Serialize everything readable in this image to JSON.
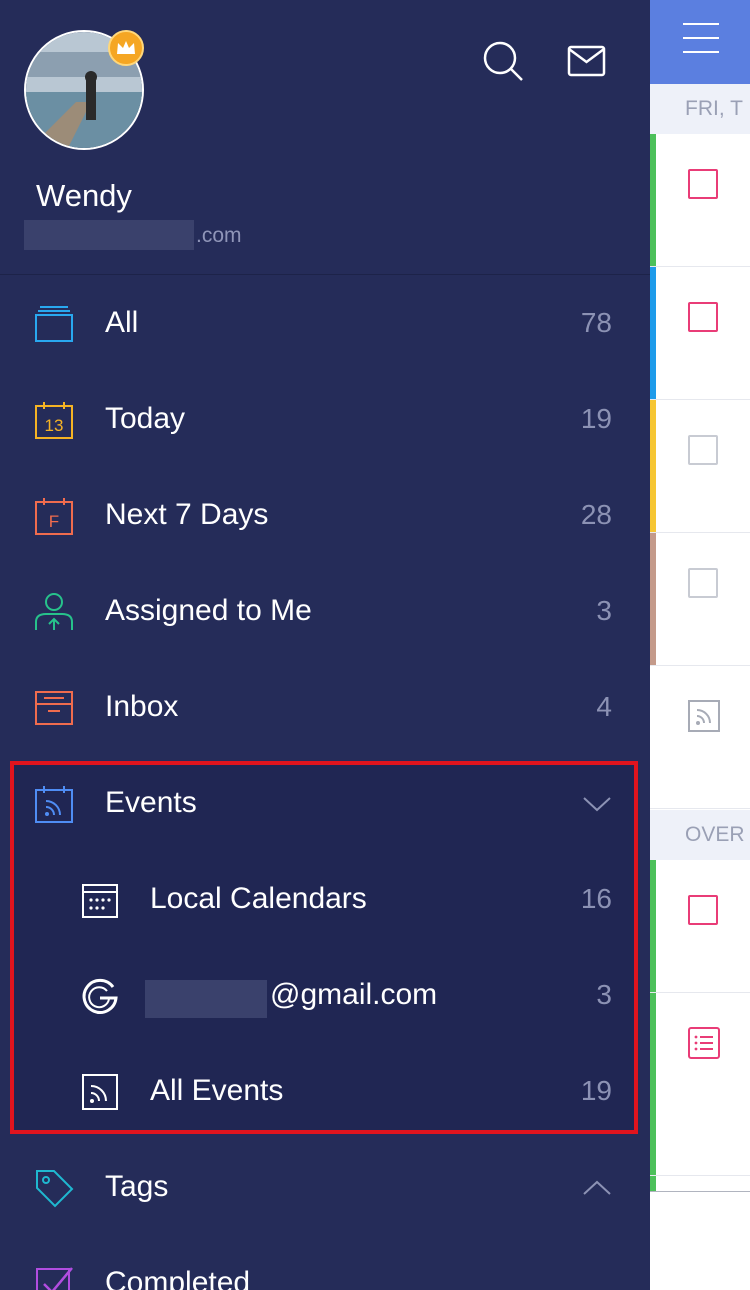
{
  "user": {
    "name": "Wendy",
    "email_suffix": ".com"
  },
  "header_icons": [
    "search-icon",
    "mail-icon"
  ],
  "nav": [
    {
      "label": "All",
      "count": "78",
      "icon": "all-stack-icon",
      "color": "#29a8f0"
    },
    {
      "label": "Today",
      "count": "19",
      "icon": "calendar-13-icon",
      "icon_text": "13",
      "color": "#f5b324"
    },
    {
      "label": "Next 7 Days",
      "count": "28",
      "icon": "calendar-f-icon",
      "icon_text": "F",
      "color": "#f06c4e"
    },
    {
      "label": "Assigned to Me",
      "count": "3",
      "icon": "assigned-user-icon",
      "color": "#27c28b"
    },
    {
      "label": "Inbox",
      "count": "4",
      "icon": "inbox-tray-icon",
      "color": "#f06c4e"
    }
  ],
  "events": {
    "label": "Events",
    "icon": "events-calendar-icon",
    "expanded": true,
    "items": [
      {
        "label": "Local Calendars",
        "count": "16",
        "icon": "local-calendar-icon"
      },
      {
        "label": "@gmail.com",
        "count": "3",
        "icon": "google-icon"
      },
      {
        "label": "All Events",
        "count": "19",
        "icon": "rss-feed-icon"
      }
    ]
  },
  "tags": {
    "label": "Tags",
    "icon": "tag-icon"
  },
  "completed": {
    "label": "Completed",
    "icon": "completed-check-icon"
  },
  "right_panel": {
    "menu_icon": "hamburger-menu-icon",
    "section1": "FRI, T",
    "section2": "OVER"
  },
  "colors": {
    "sidebar": "#252c59",
    "highlight": "#e0141e",
    "topbar": "#5b7fe0"
  }
}
